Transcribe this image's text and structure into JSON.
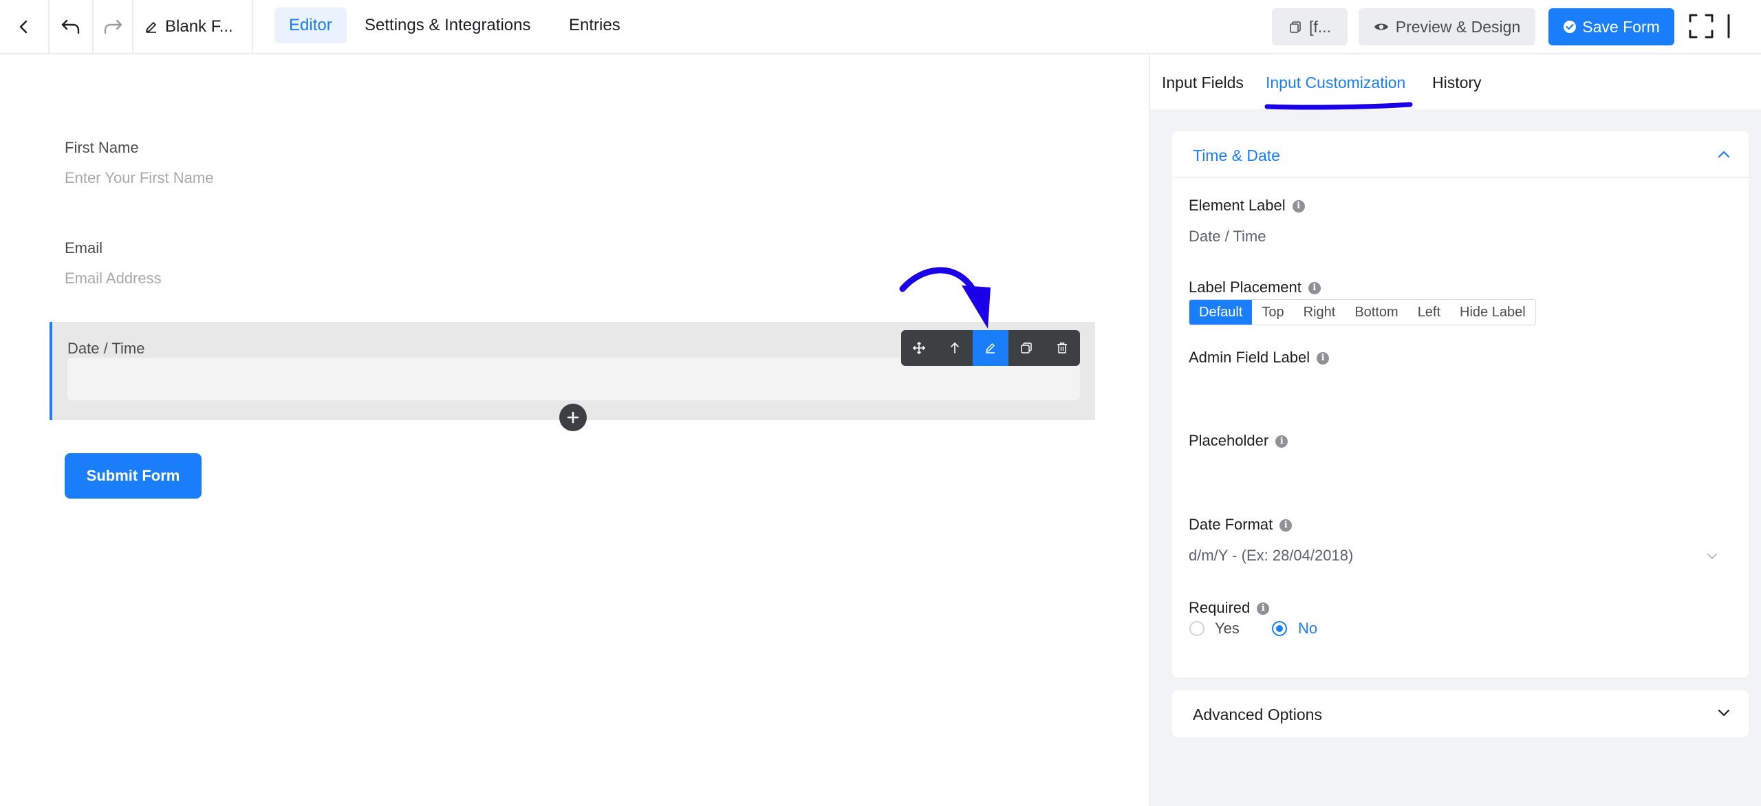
{
  "topbar": {
    "form_title": "Blank F...",
    "nav": [
      "Editor",
      "Settings & Integrations",
      "Entries"
    ],
    "shortcode_label": "[f...",
    "preview_label": "Preview & Design",
    "save_label": "Save Form"
  },
  "canvas": {
    "fields": [
      {
        "label": "First Name",
        "placeholder": "Enter Your First Name"
      },
      {
        "label": "Email",
        "placeholder": "Email Address"
      }
    ],
    "datetime_label": "Date / Time",
    "submit_label": "Submit Form"
  },
  "panel": {
    "tabs": [
      "Input Fields",
      "Input Customization",
      "History"
    ],
    "section_title": "Time & Date",
    "element_label": {
      "label": "Element Label",
      "value": "Date / Time"
    },
    "label_placement": {
      "label": "Label Placement",
      "options": [
        "Default",
        "Top",
        "Right",
        "Bottom",
        "Left",
        "Hide Label"
      ],
      "selected": "Default"
    },
    "admin_field_label": {
      "label": "Admin Field Label",
      "value": ""
    },
    "placeholder": {
      "label": "Placeholder",
      "value": ""
    },
    "date_format": {
      "label": "Date Format",
      "value": "d/m/Y - (Ex: 28/04/2018)"
    },
    "required": {
      "label": "Required",
      "options": [
        "Yes",
        "No"
      ],
      "selected": "No"
    },
    "advanced_title": "Advanced Options"
  },
  "colors": {
    "accent": "#1a7efb",
    "annotation": "#1a00e8",
    "toolbar": "#3c4043"
  }
}
